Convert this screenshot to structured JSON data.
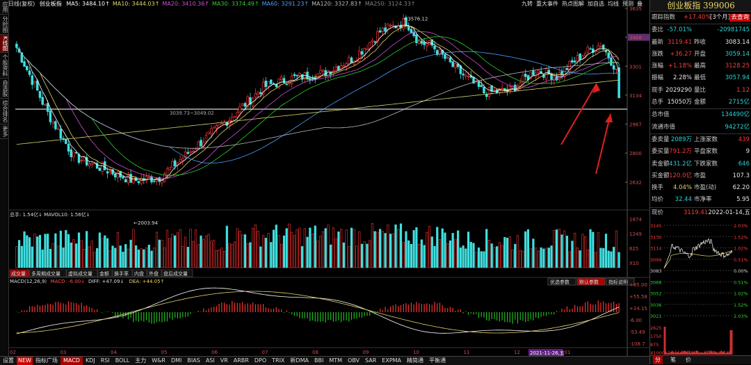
{
  "left_tabs": [
    "应用",
    "分时图",
    "K线图",
    "个股资料",
    "自选股",
    "综合排名",
    "更多"
  ],
  "top_info": {
    "period": "日线(复权)",
    "name": "创业板指",
    "ma": [
      {
        "t": "MA5: 3484.10↑",
        "c": "#ffffff"
      },
      {
        "t": "MA10: 3444.03↑",
        "c": "#e8d66a"
      },
      {
        "t": "MA20: 3410.36↑",
        "c": "#d050d0"
      },
      {
        "t": "MA30: 3374.49↑",
        "c": "#2fd02f"
      },
      {
        "t": "MA60: 3291.23↑",
        "c": "#4aa0ff"
      },
      {
        "t": "MA120: 3327.83↑",
        "c": "#bbbbbb"
      },
      {
        "t": "MA250: 3124.33↑",
        "c": "#808080"
      }
    ]
  },
  "toolbar": [
    "九转",
    "重大事件",
    "热点图解",
    "加自选",
    "均线",
    "预测",
    "叠"
  ],
  "price_axis": [
    "3635",
    "3468",
    "3301",
    "3134",
    "2967",
    "2800",
    "2632"
  ],
  "price_highlight": "3468",
  "volume_axis": [
    "1874",
    "1249",
    "625",
    "X10"
  ],
  "macd_axis": [
    "+85.00",
    "+55.58",
    "+24.15",
    "-6.00",
    "-53.49",
    "-108.7"
  ],
  "annotations": {
    "high": "3576.12",
    "low": "2003.94",
    "hline": "3039.73~3049.02"
  },
  "volume_info": "总手: 1.54亿↓  MAVOL10: 1.56亿↓",
  "volume_tabs": [
    "成交量",
    "多周期成交量",
    "虚拟成交量",
    "金额",
    "换手率",
    "内盘",
    "外盘",
    "盘后成交量"
  ],
  "macd_info": {
    "name": "MACD(12,26,9)",
    "macd": "MACD: -6.00↓",
    "diff": "DIFF: +47.09↓",
    "dea": "DEA: +44.05↑"
  },
  "macd_buttons": [
    "优选参数",
    "默认参数",
    "指标说明"
  ],
  "x_labels": [
    "02",
    "03",
    "04",
    "05",
    "06",
    "07",
    "08",
    "09",
    "10",
    "11",
    "12",
    "01"
  ],
  "date_cursor": "2021-11-26,五",
  "bottom_tabs": [
    "设置",
    "NEW",
    "指标广场",
    "MACD",
    "KDJ",
    "RSI",
    "BOLL",
    "主力",
    "W&R",
    "DMI",
    "BIAS",
    "ASI",
    "VR",
    "ARBR",
    "DPO",
    "TRIX",
    "新DMA",
    "BBI",
    "MTM",
    "OBV",
    "SAR",
    "EXPMA",
    "精简通",
    "平衡通"
  ],
  "bottom_active": "MACD",
  "panel": {
    "title": "创业板指 399006",
    "follow": {
      "label": "跟踪指数",
      "value": "+17.40%",
      "period": "[3个月]",
      "btn": "去查询"
    },
    "rows": [
      {
        "l": "委比",
        "v1": "-57.01%",
        "c1": "grn",
        "l2": "",
        "v2": "-20981745",
        "c2": "grn"
      },
      {
        "l": "最新",
        "v1": "3119.41",
        "c1": "red",
        "l2": "昨收",
        "v2": "3083.14",
        "c2": "wht"
      },
      {
        "l": "涨跌",
        "v1": "+36.27",
        "c1": "red",
        "l2": "开盘",
        "v2": "3059.14",
        "c2": "grn"
      },
      {
        "l": "涨幅",
        "v1": "+1.18%",
        "c1": "red",
        "l2": "最高",
        "v2": "3128.25",
        "c2": "red"
      },
      {
        "l": "振幅",
        "v1": "2.28%",
        "c1": "wht",
        "l2": "最低",
        "v2": "3057.94",
        "c2": "grn"
      },
      {
        "l": "现手",
        "v1": "2029290",
        "c1": "wht",
        "l2": "量比",
        "v2": "1.12",
        "c2": "red"
      },
      {
        "l": "总手",
        "v1": "15050万",
        "c1": "wht",
        "l2": "金额",
        "v2": "2715亿",
        "c2": "grn"
      }
    ],
    "rows2": [
      {
        "l": "总市值",
        "v2": "134490亿",
        "c2": "grn"
      },
      {
        "l": "流通市值",
        "v2": "94272亿",
        "c2": "grn"
      }
    ],
    "rows3": [
      {
        "l": "委卖量",
        "v1": "2089万",
        "c1": "grn",
        "l2": "上涨家数",
        "v2": "439",
        "c2": "red"
      },
      {
        "l": "委买量",
        "v1": "791.2万",
        "c1": "red",
        "l2": "平盘家数",
        "v2": "9",
        "c2": "wht"
      },
      {
        "l": "卖金额",
        "v1": "431.2亿",
        "c1": "grn",
        "l2": "下跌家数",
        "v2": "646",
        "c2": "grn"
      },
      {
        "l": "买金额",
        "v1": "120.0亿",
        "c1": "red",
        "l2": "市盈",
        "v2": "107.3",
        "c2": "wht"
      },
      {
        "l": "换手",
        "v1": "4.04%",
        "c1": "yel",
        "l2": "市盈(动)",
        "v2": "62.20",
        "c2": "wht"
      },
      {
        "l": "均价",
        "v1": "32.44",
        "c1": "grn",
        "l2": "市净率",
        "v2": "5.95",
        "c2": "wht"
      }
    ],
    "timeline": {
      "label": "现价",
      "price": "3119.41",
      "date": "2022-01-14,五",
      "left_axis": [
        "3145",
        "3130",
        "3114",
        "3099",
        "3083",
        "3068",
        "3052",
        "3036",
        "3021",
        "2625",
        "1750",
        "875",
        "X1000"
      ],
      "right_axis": [
        "2.03%",
        "1.52%",
        "1.02%",
        "0.51%",
        "0.00%",
        "0.51%",
        "1.02%",
        "1.52%",
        "2.03%"
      ]
    },
    "bottom": [
      "分",
      "笔",
      "价"
    ]
  }
}
